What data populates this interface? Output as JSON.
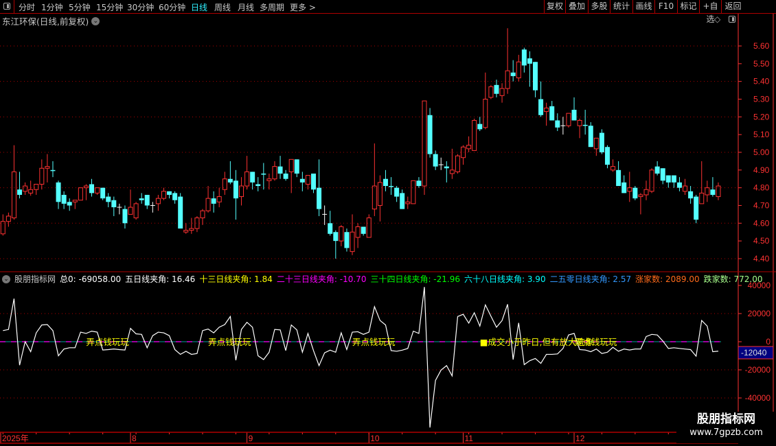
{
  "toolbar": {
    "periods": [
      "分时",
      "1分钟",
      "5分钟",
      "15分钟",
      "30分钟",
      "60分钟",
      "日线",
      "周线",
      "月线",
      "多周期",
      "更多 >"
    ],
    "active_period": "日线",
    "buttons": [
      "复权",
      "叠加",
      "多股",
      "统计",
      "画线",
      "F10",
      "标记",
      "+自选",
      "返回"
    ]
  },
  "title": "东江环保(日线,前复权)",
  "indicator_legend": [
    {
      "text": "股朋指标网",
      "color": "#c8c8c8"
    },
    {
      "text": "总0: -69058.00",
      "color": "#ffffff"
    },
    {
      "text": "五日线夹角: 16.46",
      "color": "#ffffff"
    },
    {
      "text": "十三日线夹角: 1.84",
      "color": "#ffff00"
    },
    {
      "text": "二十三日线夹角: -10.70",
      "color": "#ff00ff"
    },
    {
      "text": "三十四日线夹角: -21.96",
      "color": "#00ff00"
    },
    {
      "text": "六十八日线夹角: 3.90",
      "color": "#00ffff"
    },
    {
      "text": "二五零日线夹角: 2.57",
      "color": "#3399ff"
    },
    {
      "text": "涨家数: 2089.00",
      "color": "#ff6a1a"
    },
    {
      "text": "跌家数: 772.00",
      "color": "#a8ff8c"
    }
  ],
  "watermark": {
    "line1": "股朋指标网",
    "line2": "www.7gpzb.com"
  },
  "colors": {
    "up": "#ff3232",
    "down": "#54ffff",
    "flat": "#ffffff",
    "axis": "#ff3232",
    "grid": "#b00000",
    "zero_line": "#ff00ff",
    "signal_text": "#ffff00"
  },
  "chart_data": [
    {
      "type": "candlestick",
      "ylim": [
        4.36,
        5.72
      ],
      "y_ticks": [
        "5.60",
        "5.50",
        "5.40",
        "5.30",
        "5.20",
        "5.10",
        "5.00",
        "4.90",
        "4.80",
        "4.70",
        "4.60",
        "4.50",
        "4.40"
      ],
      "x_ticks": [
        {
          "label": "2025年",
          "index": 1
        },
        {
          "label": "8",
          "index": 24
        },
        {
          "label": "9",
          "index": 45
        },
        {
          "label": "10",
          "index": 67
        },
        {
          "label": "11",
          "index": 84
        },
        {
          "label": "12",
          "index": 104
        }
      ],
      "grid": "dotted every 0.20",
      "candles_ohlc": [
        [
          4.54,
          4.65,
          4.53,
          4.61
        ],
        [
          4.61,
          4.66,
          4.58,
          4.64
        ],
        [
          4.63,
          5.04,
          4.62,
          4.89
        ],
        [
          4.79,
          4.89,
          4.74,
          4.76
        ],
        [
          4.78,
          4.83,
          4.76,
          4.81
        ],
        [
          4.77,
          4.84,
          4.755,
          4.79
        ],
        [
          4.79,
          4.82,
          4.76,
          4.82
        ],
        [
          4.82,
          4.96,
          4.79,
          4.91
        ],
        [
          4.91,
          4.99,
          4.83,
          4.92
        ],
        [
          4.9,
          4.95,
          4.86,
          4.895
        ],
        [
          4.83,
          4.84,
          4.68,
          4.72
        ],
        [
          4.76,
          4.78,
          4.68,
          4.71
        ],
        [
          4.72,
          4.74,
          4.67,
          4.7
        ],
        [
          4.72,
          4.73,
          4.68,
          4.73
        ],
        [
          4.73,
          4.8,
          4.73,
          4.8
        ],
        [
          4.8,
          4.82,
          4.73,
          4.81
        ],
        [
          4.82,
          4.85,
          4.75,
          4.77
        ],
        [
          4.77,
          4.8,
          4.76,
          4.8
        ],
        [
          4.8,
          4.8,
          4.73,
          4.74
        ],
        [
          4.75,
          4.77,
          4.69,
          4.72
        ],
        [
          4.73,
          4.75,
          4.64,
          4.69
        ],
        [
          4.69,
          4.71,
          4.65,
          4.69
        ],
        [
          4.68,
          4.7,
          4.57,
          4.6
        ],
        [
          4.65,
          4.79,
          4.65,
          4.69
        ],
        [
          4.63,
          4.72,
          4.62,
          4.71
        ],
        [
          4.74,
          4.77,
          4.71,
          4.73
        ],
        [
          4.76,
          4.76,
          4.68,
          4.7
        ],
        [
          4.7,
          4.72,
          4.66,
          4.7
        ],
        [
          4.71,
          4.76,
          4.67,
          4.74
        ],
        [
          4.74,
          4.8,
          4.73,
          4.78
        ],
        [
          4.78,
          4.78,
          4.74,
          4.76
        ],
        [
          4.77,
          4.78,
          4.71,
          4.73
        ],
        [
          4.75,
          4.77,
          4.57,
          4.57
        ],
        [
          4.55,
          4.6,
          4.54,
          4.56
        ],
        [
          4.56,
          4.63,
          4.54,
          4.57
        ],
        [
          4.57,
          4.64,
          4.55,
          4.63
        ],
        [
          4.63,
          4.68,
          4.59,
          4.67
        ],
        [
          4.67,
          4.81,
          4.66,
          4.74
        ],
        [
          4.74,
          4.78,
          4.66,
          4.71
        ],
        [
          4.72,
          4.8,
          4.69,
          4.75
        ],
        [
          4.79,
          4.89,
          4.76,
          4.85
        ],
        [
          4.85,
          4.95,
          4.82,
          4.83
        ],
        [
          4.84,
          4.9,
          4.62,
          4.74
        ],
        [
          4.75,
          4.86,
          4.7,
          4.81
        ],
        [
          4.81,
          4.98,
          4.79,
          4.89
        ],
        [
          4.89,
          4.89,
          4.79,
          4.83
        ],
        [
          4.82,
          4.86,
          4.78,
          4.81
        ],
        [
          4.88,
          4.94,
          4.79,
          4.875
        ],
        [
          4.84,
          4.88,
          4.79,
          4.85
        ],
        [
          4.85,
          4.95,
          4.84,
          4.92
        ],
        [
          4.92,
          4.98,
          4.85,
          4.88
        ],
        [
          4.88,
          4.9,
          4.84,
          4.85
        ],
        [
          4.89,
          4.96,
          4.77,
          4.96
        ],
        [
          4.96,
          4.96,
          4.86,
          4.88
        ],
        [
          4.85,
          4.89,
          4.78,
          4.83
        ],
        [
          4.82,
          4.87,
          4.79,
          4.87
        ],
        [
          4.88,
          4.88,
          4.77,
          4.79
        ],
        [
          4.8,
          4.96,
          4.64,
          4.68
        ],
        [
          4.65,
          4.7,
          4.59,
          4.65
        ],
        [
          4.6,
          4.67,
          4.53,
          4.54
        ],
        [
          4.55,
          4.56,
          4.4,
          4.5
        ],
        [
          4.5,
          4.59,
          4.47,
          4.58
        ],
        [
          4.55,
          4.57,
          4.44,
          4.46
        ],
        [
          4.44,
          4.65,
          4.42,
          4.55
        ],
        [
          4.52,
          4.6,
          4.46,
          4.58
        ],
        [
          4.58,
          4.58,
          4.53,
          4.54
        ],
        [
          4.52,
          4.65,
          4.52,
          4.63
        ],
        [
          4.68,
          5.05,
          4.64,
          4.81
        ],
        [
          4.7,
          4.87,
          4.61,
          4.83
        ],
        [
          4.85,
          4.9,
          4.78,
          4.81
        ],
        [
          4.81,
          4.86,
          4.76,
          4.805
        ],
        [
          4.8,
          4.81,
          4.72,
          4.75
        ],
        [
          4.77,
          4.79,
          4.68,
          4.68
        ],
        [
          4.71,
          4.75,
          4.68,
          4.72
        ],
        [
          4.71,
          4.84,
          4.71,
          4.84
        ],
        [
          4.84,
          4.86,
          4.8,
          4.81
        ],
        [
          4.81,
          5.29,
          4.76,
          5.29
        ],
        [
          5.21,
          5.25,
          4.97,
          4.99
        ],
        [
          4.99,
          5.01,
          4.9,
          4.92
        ],
        [
          4.93,
          4.97,
          4.9,
          4.93
        ],
        [
          4.92,
          4.95,
          4.83,
          4.91
        ],
        [
          4.88,
          5.02,
          4.85,
          4.9
        ],
        [
          4.89,
          4.99,
          4.88,
          4.98
        ],
        [
          4.97,
          5.04,
          4.93,
          5.03
        ],
        [
          5.02,
          5.09,
          5.0,
          5.04
        ],
        [
          5.01,
          5.19,
          5.01,
          5.18
        ],
        [
          5.16,
          5.2,
          5.12,
          5.13
        ],
        [
          5.14,
          5.45,
          5.13,
          5.3
        ],
        [
          5.31,
          5.38,
          5.3,
          5.37
        ],
        [
          5.38,
          5.41,
          5.31,
          5.33
        ],
        [
          5.32,
          5.39,
          5.28,
          5.36
        ],
        [
          5.36,
          5.7,
          5.33,
          5.46
        ],
        [
          5.45,
          5.52,
          5.4,
          5.43
        ],
        [
          5.42,
          5.55,
          5.4,
          5.51
        ],
        [
          5.58,
          5.59,
          5.45,
          5.49
        ],
        [
          5.53,
          5.57,
          5.37,
          5.5
        ],
        [
          5.51,
          5.51,
          5.31,
          5.35
        ],
        [
          5.3,
          5.4,
          5.2,
          5.21
        ],
        [
          5.23,
          5.28,
          5.15,
          5.25
        ],
        [
          5.26,
          5.29,
          5.18,
          5.18
        ],
        [
          5.18,
          5.22,
          5.12,
          5.14
        ],
        [
          5.15,
          5.2,
          5.1,
          5.15
        ],
        [
          5.15,
          5.22,
          5.14,
          5.22
        ],
        [
          5.24,
          5.31,
          5.18,
          5.18
        ],
        [
          5.15,
          5.19,
          5.08,
          5.18
        ],
        [
          5.155,
          5.24,
          5.1,
          5.15
        ],
        [
          5.15,
          5.17,
          5.03,
          5.03
        ],
        [
          5.02,
          5.08,
          4.98,
          5.08
        ],
        [
          5.11,
          5.13,
          4.99,
          5.0
        ],
        [
          5.03,
          5.04,
          4.91,
          4.93
        ],
        [
          4.9,
          4.96,
          4.89,
          4.92
        ],
        [
          4.9,
          4.95,
          4.81,
          4.81
        ],
        [
          4.83,
          4.87,
          4.77,
          4.77
        ],
        [
          4.78,
          4.89,
          4.72,
          4.8
        ],
        [
          4.8,
          4.81,
          4.73,
          4.74
        ],
        [
          4.75,
          4.77,
          4.65,
          4.76
        ],
        [
          4.76,
          4.84,
          4.73,
          4.79
        ],
        [
          4.78,
          4.91,
          4.77,
          4.9
        ],
        [
          4.92,
          4.95,
          4.87,
          4.88
        ],
        [
          4.91,
          4.91,
          4.82,
          4.84
        ],
        [
          4.87,
          4.87,
          4.8,
          4.83
        ],
        [
          4.87,
          4.87,
          4.8,
          4.83
        ],
        [
          4.83,
          4.86,
          4.78,
          4.8
        ],
        [
          4.78,
          4.85,
          4.76,
          4.81
        ],
        [
          4.78,
          4.81,
          4.71,
          4.74
        ],
        [
          4.75,
          4.76,
          4.6,
          4.62
        ],
        [
          4.71,
          4.95,
          4.71,
          4.77
        ],
        [
          4.76,
          4.84,
          4.72,
          4.8
        ],
        [
          4.79,
          4.86,
          4.75,
          4.76
        ],
        [
          4.75,
          4.83,
          4.73,
          4.81
        ]
      ]
    },
    {
      "type": "line",
      "ylim": [
        -64000,
        46000
      ],
      "y_ticks": [
        "40000",
        "20000",
        "0",
        "-20000",
        "-40000"
      ],
      "current_value_label": "-12040",
      "values": [
        7900,
        8700,
        30600,
        -16700,
        0,
        -7100,
        6300,
        11900,
        12200,
        7900,
        -10000,
        -5200,
        -4300,
        -4300,
        6800,
        5900,
        7500,
        6800,
        -5900,
        -5600,
        -5200,
        -5600,
        -5900,
        9500,
        5600,
        5200,
        -4300,
        4300,
        6800,
        6300,
        4300,
        -5600,
        -9000,
        -6800,
        -9000,
        -8400,
        7900,
        9000,
        6300,
        10300,
        12200,
        17900,
        -13200,
        8700,
        13800,
        10300,
        -10000,
        -12700,
        -7500,
        8700,
        8400,
        -6300,
        11900,
        8400,
        -7500,
        5900,
        -6300,
        -17000,
        -7900,
        -6000,
        -7500,
        6300,
        -5600,
        6800,
        7100,
        5200,
        6800,
        24900,
        15100,
        11900,
        -6300,
        -6800,
        -6000,
        -4800,
        7500,
        5900,
        38900,
        -61000,
        -27500,
        -20200,
        -17000,
        -24300,
        17900,
        19500,
        13200,
        20600,
        11100,
        26200,
        18100,
        10300,
        15000,
        26600,
        -12700,
        13400,
        -16300,
        -13500,
        -11900,
        -15400,
        -9000,
        -9000,
        -8700,
        -4800,
        4800,
        5900,
        -5600,
        -5900,
        -7100,
        -5200,
        -8400,
        -7500,
        -4000,
        -6800,
        -5200,
        -5900,
        -5200,
        -5200,
        3700,
        5200,
        4800,
        500,
        -4800,
        -4300,
        -4800,
        -5200,
        -5600,
        -10300,
        15100,
        11100,
        -7100,
        -6700
      ],
      "signals": [
        {
          "text": "弄点钱玩玩",
          "index": 15
        },
        {
          "text": "弄点钱玩玩",
          "index": 37
        },
        {
          "text": "弄点钱玩玩",
          "index": 63
        },
        {
          "text": "■成交小于昨日,但有放大迹象",
          "index": 86
        },
        {
          "text": "弄点钱玩玩",
          "index": 103
        }
      ]
    }
  ]
}
